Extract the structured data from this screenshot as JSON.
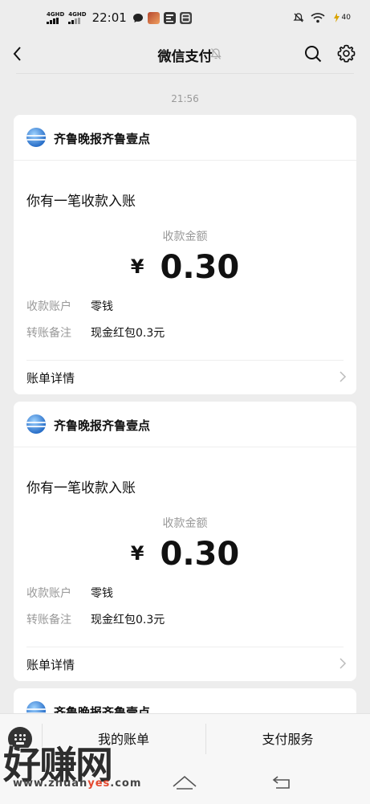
{
  "status_bar": {
    "network1": "4GHD",
    "network2": "4GHD",
    "time": "22:01",
    "battery": "40",
    "icons": [
      "signal-icon",
      "chat-bubble-icon",
      "game-app-icon",
      "app-icon",
      "app-icon",
      "mute-icon",
      "wifi-icon",
      "battery-icon"
    ]
  },
  "nav": {
    "title": "微信支付",
    "icons": [
      "back-icon",
      "mute-bell-icon",
      "search-icon",
      "gear-icon"
    ]
  },
  "timestamp": "21:56",
  "cards": [
    {
      "source": "齐鲁晚报齐鲁壹点",
      "headline": "你有一笔收款入账",
      "amount_label": "收款金额",
      "currency": "¥",
      "amount": "0.30",
      "account_label": "收款账户",
      "account_value": "零钱",
      "note_label": "转账备注",
      "note_value": "现金红包0.3元",
      "detail_label": "账单详情"
    },
    {
      "source": "齐鲁晚报齐鲁壹点",
      "headline": "你有一笔收款入账",
      "amount_label": "收款金额",
      "currency": "¥",
      "amount": "0.30",
      "account_label": "收款账户",
      "account_value": "零钱",
      "note_label": "转账备注",
      "note_value": "现金红包0.3元",
      "detail_label": "账单详情"
    },
    {
      "source": "齐鲁晚报齐鲁壹点"
    }
  ],
  "bottom_tabs": [
    "我的账单",
    "支付服务"
  ],
  "watermark": {
    "text": "好赚网",
    "url_prefix": "www.zhuan",
    "url_highlight": "yes",
    "url_suffix": ".com"
  },
  "colors": {
    "background": "#ededed",
    "card": "#ffffff",
    "muted_text": "#999999",
    "watermark_highlight": "#e4472d"
  }
}
